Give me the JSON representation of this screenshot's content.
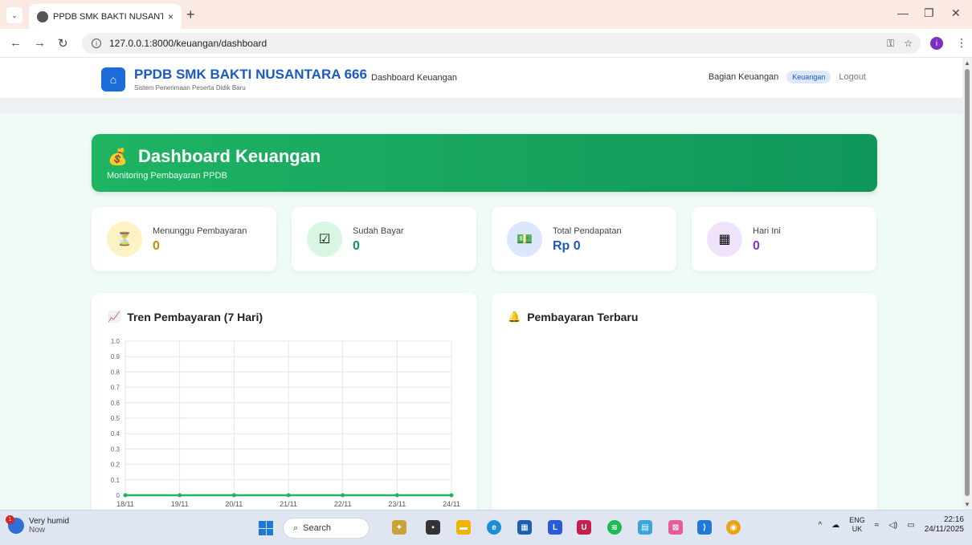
{
  "browser": {
    "tab_title": "PPDB SMK BAKTI NUSANTARA",
    "tab_close": "×",
    "new_tab": "+",
    "url": "127.0.0.1:8000/keuangan/dashboard"
  },
  "header": {
    "brand_title": "PPDB SMK BAKTI NUSANTARA 666",
    "brand_subtitle": "Sistem Penerimaan Peserta Didik Baru",
    "nav_link": "Dashboard Keuangan",
    "user_section": "Bagian Keuangan",
    "role_badge": "Keuangan",
    "logout": "Logout"
  },
  "hero": {
    "title": "Dashboard Keuangan",
    "subtitle": "Monitoring Pembayaran PPDB",
    "icon": "money-bag-icon"
  },
  "stats": [
    {
      "label": "Menunggu Pembayaran",
      "value": "0",
      "icon": "hourglass-icon",
      "color": "#c98a06",
      "bg": "#fdf2c4"
    },
    {
      "label": "Sudah Bayar",
      "value": "0",
      "icon": "check-icon",
      "color": "#17924e",
      "bg": "#d9f5e3"
    },
    {
      "label": "Total Pendapatan",
      "value": "Rp 0",
      "icon": "money-icon",
      "color": "#1b59c4",
      "bg": "#dbe7fb"
    },
    {
      "label": "Hari Ini",
      "value": "0",
      "icon": "calendar-icon",
      "color": "#8a2fd0",
      "bg": "#efe3fb"
    }
  ],
  "panels": {
    "trend_title": "Tren Pembayaran (7 Hari)",
    "recent_title": "Pembayaran Terbaru"
  },
  "chart_data": {
    "type": "line",
    "categories": [
      "18/11",
      "19/11",
      "20/11",
      "21/11",
      "22/11",
      "23/11",
      "24/11"
    ],
    "series": [
      {
        "values": [
          0,
          0,
          0,
          0,
          0,
          0,
          0
        ]
      }
    ],
    "title": "Tren Pembayaran (7 Hari)",
    "ylim": [
      0,
      1.0
    ],
    "yticks": [
      "1.0",
      "0.9",
      "0.8",
      "0.7",
      "0.6",
      "0.5",
      "0.4",
      "0.3",
      "0.2",
      "0.1",
      "0"
    ],
    "grid": true,
    "line_color": "#22b35f"
  },
  "taskbar": {
    "weather_label": "Very humid",
    "weather_sub": "Now",
    "weather_badge": "1",
    "search_label": "Search",
    "lang_top": "ENG",
    "lang_bottom": "UK",
    "time": "22:16",
    "date": "24/11/2025"
  }
}
